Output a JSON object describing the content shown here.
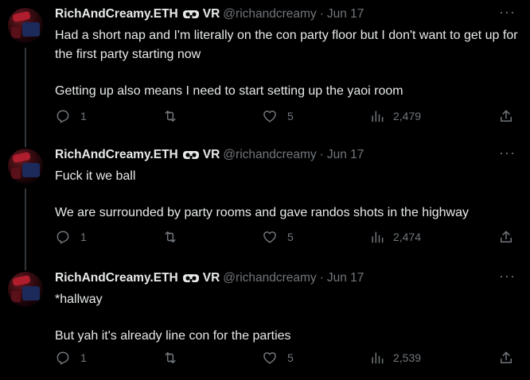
{
  "tweets": [
    {
      "display_name": "RichAndCreamy.ETH",
      "badge_text": "VR",
      "badge_icon": "vr-headset-icon",
      "handle": "@richandcreamy",
      "separator": "·",
      "date": "Jun 17",
      "more": "···",
      "paragraphs": [
        "Had a short nap and I'm literally on the con party floor but I don't want to get up for the first party starting now",
        "Getting up also means I need to start setting up the yaoi room"
      ],
      "replies": "1",
      "retweets": "",
      "likes": "5",
      "views": "2,479"
    },
    {
      "display_name": "RichAndCreamy.ETH",
      "badge_text": "VR",
      "badge_icon": "vr-headset-icon",
      "handle": "@richandcreamy",
      "separator": "·",
      "date": "Jun 17",
      "more": "···",
      "paragraphs": [
        "Fuck it we ball",
        "We are surrounded by party rooms and gave randos shots in the highway"
      ],
      "replies": "1",
      "retweets": "",
      "likes": "5",
      "views": "2,474"
    },
    {
      "display_name": "RichAndCreamy.ETH",
      "badge_text": "VR",
      "badge_icon": "vr-headset-icon",
      "handle": "@richandcreamy",
      "separator": "·",
      "date": "Jun 17",
      "more": "···",
      "paragraphs": [
        "*hallway",
        "But yah it's already line con for the parties"
      ],
      "replies": "1",
      "retweets": "",
      "likes": "5",
      "views": "2,539"
    }
  ],
  "colors": {
    "background": "#000000",
    "text": "#e7e9ea",
    "secondary": "#71767b",
    "thread_line": "#333639"
  }
}
